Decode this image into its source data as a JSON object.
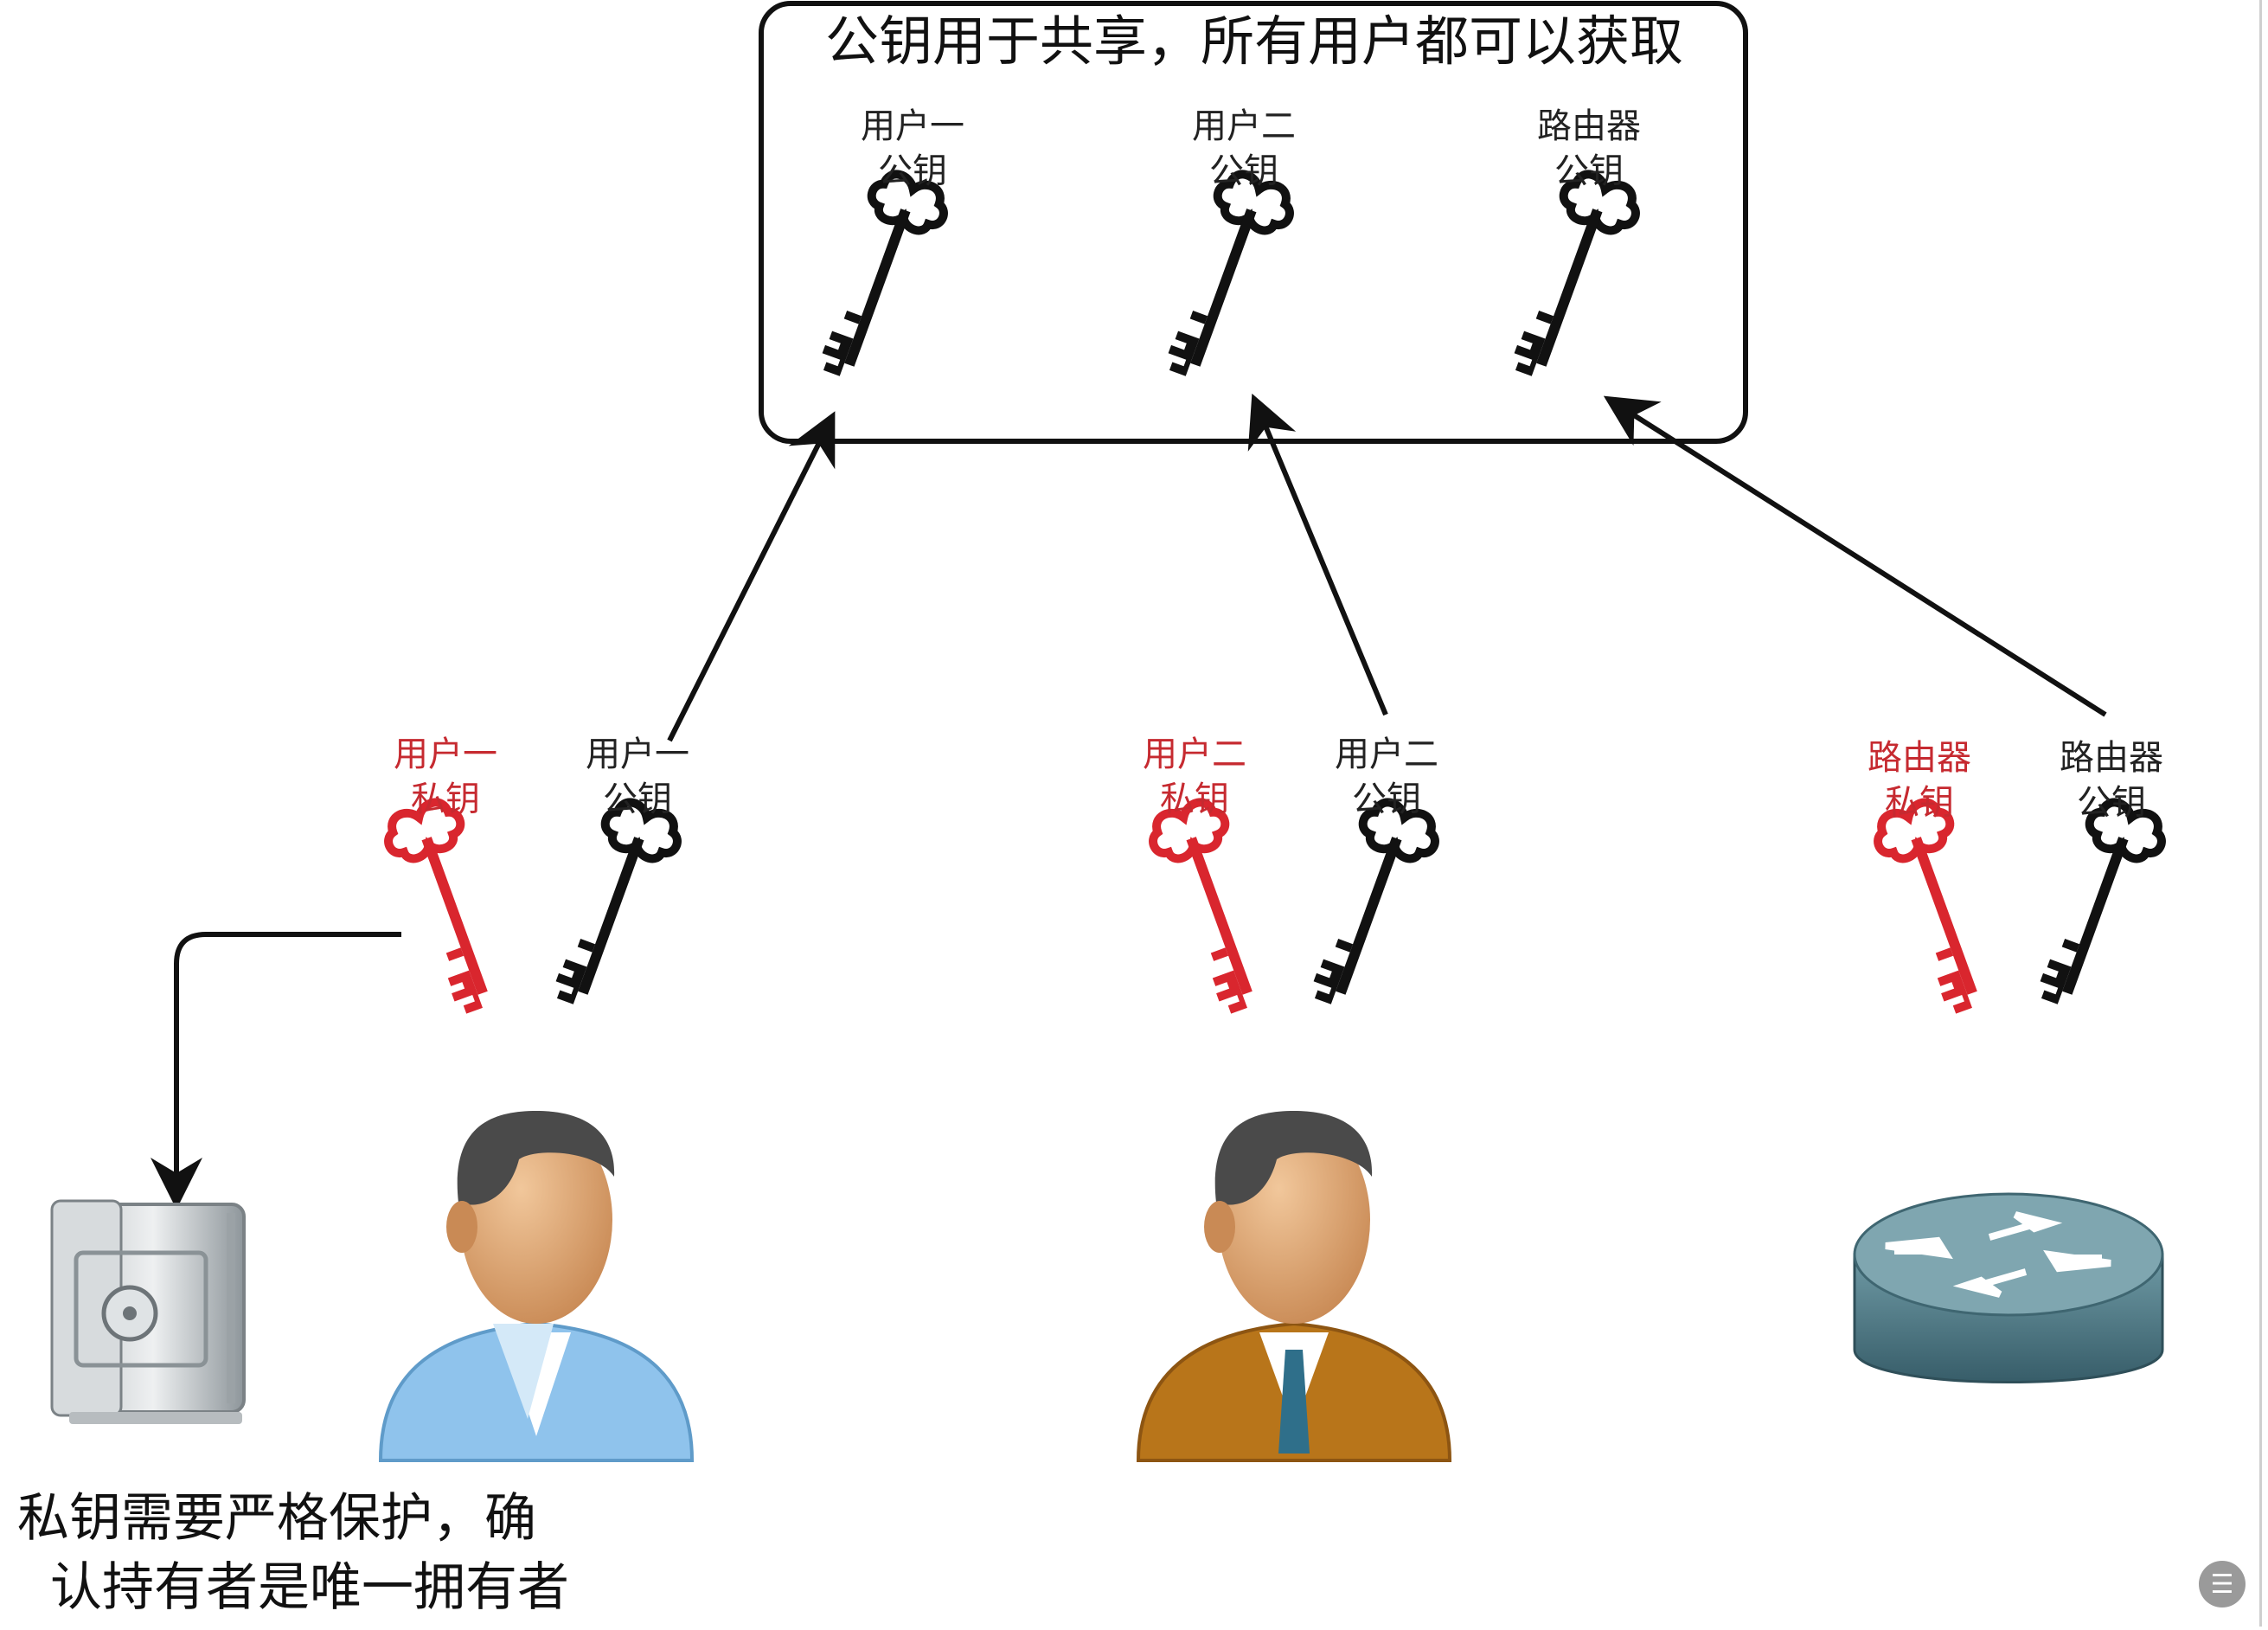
{
  "shared_box": {
    "title": "公钥用于共享，所有用户都可以获取",
    "keys": [
      {
        "line1": "用户一",
        "line2": "公钥"
      },
      {
        "line1": "用户二",
        "line2": "公钥"
      },
      {
        "line1": "路由器",
        "line2": "公钥"
      }
    ]
  },
  "entities": [
    {
      "private_key": {
        "line1": "用户一",
        "line2": "私钥"
      },
      "public_key": {
        "line1": "用户一",
        "line2": "公钥"
      },
      "icon": "user-blue-icon"
    },
    {
      "private_key": {
        "line1": "用户二",
        "line2": "私钥"
      },
      "public_key": {
        "line1": "用户二",
        "line2": "公钥"
      },
      "icon": "user-brown-icon"
    },
    {
      "private_key": {
        "line1": "路由器",
        "line2": "私钥"
      },
      "public_key": {
        "line1": "路由器",
        "line2": "公钥"
      },
      "icon": "router-icon"
    }
  ],
  "note": {
    "line1": "私钥需要严格保护，确",
    "line2": "认持有者是唯一拥有者"
  },
  "colors": {
    "private_key": "#d9262e",
    "public_key": "#111111",
    "user_one_shirt": "#8fc3ec",
    "user_two_suit": "#b8751a",
    "router_body": "#4f7a86"
  }
}
